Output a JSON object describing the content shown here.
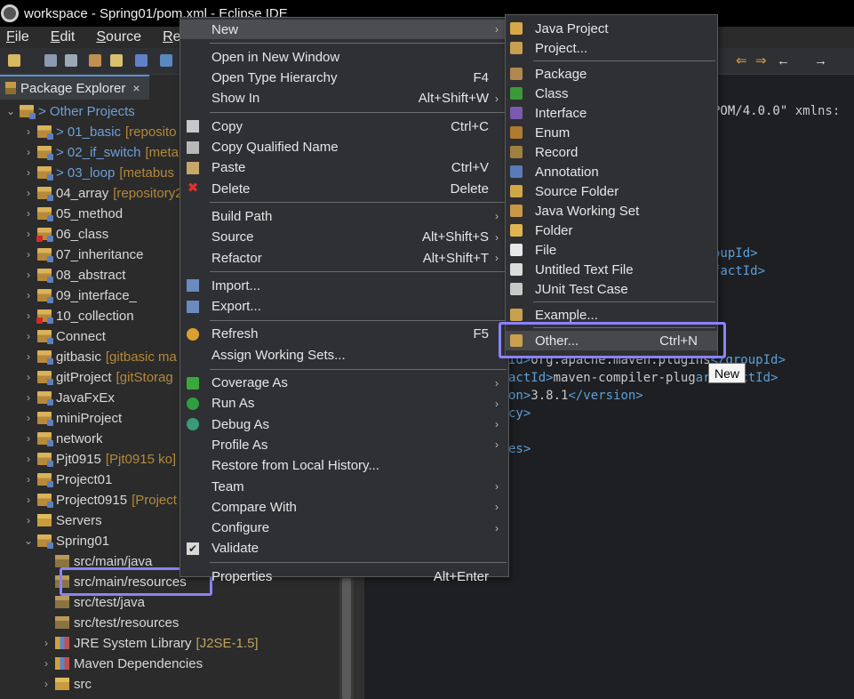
{
  "window": {
    "title": "workspace - Spring01/pom.xml - Eclipse IDE"
  },
  "menubar": {
    "items": [
      "File",
      "Edit",
      "Source",
      "Ref"
    ]
  },
  "explorer": {
    "tab_label": "Package Explorer",
    "close_glyph": "×",
    "items": [
      {
        "label": "> Other Projects",
        "decor": "",
        "indent": 0,
        "expanded": true,
        "blue": true
      },
      {
        "label": "> 01_basic",
        "decor": "[reposito",
        "indent": 1,
        "expanded": false,
        "blue": true
      },
      {
        "label": "> 02_if_switch",
        "decor": "[meta",
        "indent": 1,
        "expanded": false,
        "blue": true
      },
      {
        "label": "> 03_loop",
        "decor": "[metabus",
        "indent": 1,
        "expanded": false,
        "blue": true
      },
      {
        "label": "04_array",
        "decor": "[repository2",
        "indent": 1,
        "expanded": false
      },
      {
        "label": "05_method",
        "decor": "",
        "indent": 1,
        "expanded": false
      },
      {
        "label": "06_class",
        "decor": "",
        "indent": 1,
        "expanded": false,
        "error": true
      },
      {
        "label": "07_inheritance",
        "decor": "",
        "indent": 1,
        "expanded": false
      },
      {
        "label": "08_abstract",
        "decor": "",
        "indent": 1,
        "expanded": false
      },
      {
        "label": "09_interface_",
        "decor": "",
        "indent": 1,
        "expanded": false
      },
      {
        "label": "10_collection",
        "decor": "",
        "indent": 1,
        "expanded": false,
        "error": true
      },
      {
        "label": "Connect",
        "decor": "",
        "indent": 1,
        "expanded": false
      },
      {
        "label": "gitbasic",
        "decor": "[gitbasic ma",
        "indent": 1,
        "expanded": false
      },
      {
        "label": "gitProject",
        "decor": "[gitStorag",
        "indent": 1,
        "expanded": false
      },
      {
        "label": "JavaFxEx",
        "decor": "",
        "indent": 1,
        "expanded": false
      },
      {
        "label": "miniProject",
        "decor": "",
        "indent": 1,
        "expanded": false
      },
      {
        "label": "network",
        "decor": "",
        "indent": 1,
        "expanded": false
      },
      {
        "label": "Pjt0915",
        "decor": "[Pjt0915 ko]",
        "indent": 1,
        "expanded": false
      },
      {
        "label": "Project01",
        "decor": "",
        "indent": 1,
        "expanded": false
      },
      {
        "label": "Project0915",
        "decor": "[Project",
        "indent": 1,
        "expanded": false
      },
      {
        "label": "Servers",
        "decor": "",
        "indent": 1,
        "expanded": false,
        "kind": "folder"
      },
      {
        "label": "Spring01",
        "decor": "",
        "indent": 1,
        "expanded": true
      },
      {
        "label": "src/main/java",
        "decor": "",
        "indent": 2,
        "kind": "pkg"
      },
      {
        "label": "src/main/resources",
        "decor": "",
        "indent": 2,
        "kind": "pkg"
      },
      {
        "label": "src/test/java",
        "decor": "",
        "indent": 2,
        "kind": "pkg"
      },
      {
        "label": "src/test/resources",
        "decor": "",
        "indent": 2,
        "kind": "pkg"
      },
      {
        "label": "JRE System Library",
        "decor": "[J2SE-1.5]",
        "indent": 2,
        "expanded": false,
        "kind": "lib"
      },
      {
        "label": "Maven Dependencies",
        "decor": "",
        "indent": 2,
        "expanded": false,
        "kind": "lib"
      },
      {
        "label": "src",
        "decor": "",
        "indent": 2,
        "expanded": false,
        "kind": "folder"
      }
    ]
  },
  "editor": {
    "lines": [
      {
        "parts": [
          [
            "str",
            "POM/4.0.0\" "
          ],
          [
            "txt",
            "xmlns:"
          ]
        ]
      },
      {
        "parts": [
          [
            "tag",
            "oupId>"
          ]
        ]
      },
      {
        "parts": [
          [
            "tag",
            "factId>"
          ]
        ]
      },
      {
        "parts": [
          [
            "tag",
            "Id>"
          ],
          [
            "txt",
            "org.apache.maven.plugins"
          ],
          [
            "tag",
            "</groupId>"
          ]
        ]
      },
      {
        "parts": [
          [
            "tag",
            "actId>"
          ],
          [
            "txt",
            "maven-compiler-plug"
          ],
          [
            "tag",
            "artifactId>"
          ]
        ]
      },
      {
        "parts": [
          [
            "tag",
            "on>"
          ],
          [
            "txt",
            "3.8.1"
          ],
          [
            "tag",
            "</version>"
          ]
        ]
      },
      {
        "parts": [
          [
            "tag",
            "cy>"
          ]
        ]
      },
      {
        "parts": [
          [
            "tag",
            "es>"
          ]
        ]
      }
    ]
  },
  "context_menu": {
    "items": [
      {
        "label": "New",
        "submenu": true,
        "highlight": true
      },
      {
        "sep": true
      },
      {
        "label": "Open in New Window"
      },
      {
        "label": "Open Type Hierarchy",
        "shortcut": "F4"
      },
      {
        "label": "Show In",
        "shortcut": "Alt+Shift+W",
        "submenu": true
      },
      {
        "sep": true
      },
      {
        "label": "Copy",
        "shortcut": "Ctrl+C",
        "icon": "copy-icon"
      },
      {
        "label": "Copy Qualified Name",
        "icon": "copy-qualified-icon"
      },
      {
        "label": "Paste",
        "shortcut": "Ctrl+V",
        "icon": "paste-icon"
      },
      {
        "label": "Delete",
        "shortcut": "Delete",
        "icon": "delete-icon"
      },
      {
        "sep": true
      },
      {
        "label": "Build Path",
        "submenu": true
      },
      {
        "label": "Source",
        "shortcut": "Alt+Shift+S",
        "submenu": true
      },
      {
        "label": "Refactor",
        "shortcut": "Alt+Shift+T",
        "submenu": true
      },
      {
        "sep": true
      },
      {
        "label": "Import...",
        "icon": "import-icon"
      },
      {
        "label": "Export...",
        "icon": "export-icon"
      },
      {
        "sep": true
      },
      {
        "label": "Refresh",
        "shortcut": "F5",
        "icon": "refresh-icon"
      },
      {
        "label": "Assign Working Sets..."
      },
      {
        "sep": true
      },
      {
        "label": "Coverage As",
        "submenu": true,
        "icon": "coverage-icon"
      },
      {
        "label": "Run As",
        "submenu": true,
        "icon": "run-icon"
      },
      {
        "label": "Debug As",
        "submenu": true,
        "icon": "debug-icon"
      },
      {
        "label": "Profile As",
        "submenu": true
      },
      {
        "label": "Restore from Local History..."
      },
      {
        "label": "Team",
        "submenu": true
      },
      {
        "label": "Compare With",
        "submenu": true
      },
      {
        "label": "Configure",
        "submenu": true
      },
      {
        "label": "Validate",
        "icon": "check-icon"
      },
      {
        "sep": true
      },
      {
        "label": "Properties",
        "shortcut": "Alt+Enter"
      }
    ]
  },
  "submenu": {
    "items": [
      {
        "label": "Java Project",
        "icon": "java-project-icon",
        "color": "#d8a848"
      },
      {
        "label": "Project...",
        "icon": "project-icon",
        "color": "#c8a050"
      },
      {
        "sep": true
      },
      {
        "label": "Package",
        "icon": "package-icon",
        "color": "#b08850"
      },
      {
        "label": "Class",
        "icon": "class-icon",
        "color": "#3a9a3a"
      },
      {
        "label": "Interface",
        "icon": "interface-icon",
        "color": "#7a5ab0"
      },
      {
        "label": "Enum",
        "icon": "enum-icon",
        "color": "#b07a30"
      },
      {
        "label": "Record",
        "icon": "record-icon",
        "color": "#a08040"
      },
      {
        "label": "Annotation",
        "icon": "annotation-icon",
        "color": "#5a7ab8"
      },
      {
        "label": "Source Folder",
        "icon": "source-folder-icon",
        "color": "#d0a848"
      },
      {
        "label": "Java Working Set",
        "icon": "working-set-icon",
        "color": "#c89848"
      },
      {
        "label": "Folder",
        "icon": "folder-icon",
        "color": "#e0b450"
      },
      {
        "label": "File",
        "icon": "file-icon",
        "color": "#e8e8e8"
      },
      {
        "label": "Untitled Text File",
        "icon": "text-file-icon",
        "color": "#dcdcdc"
      },
      {
        "label": "JUnit Test Case",
        "icon": "junit-icon",
        "color": "#c8c8c8"
      },
      {
        "sep": true
      },
      {
        "label": "Example...",
        "icon": "example-icon",
        "color": "#c8a050"
      },
      {
        "sep": true
      },
      {
        "label": "Other...",
        "shortcut": "Ctrl+N",
        "icon": "other-icon",
        "color": "#c8a050",
        "highlight": true
      }
    ]
  },
  "tooltip": {
    "text": "New"
  },
  "colors": {
    "highlight_box": "#8a83ff",
    "accent_blue": "#6f9fd8",
    "decoration": "#b3893a"
  }
}
